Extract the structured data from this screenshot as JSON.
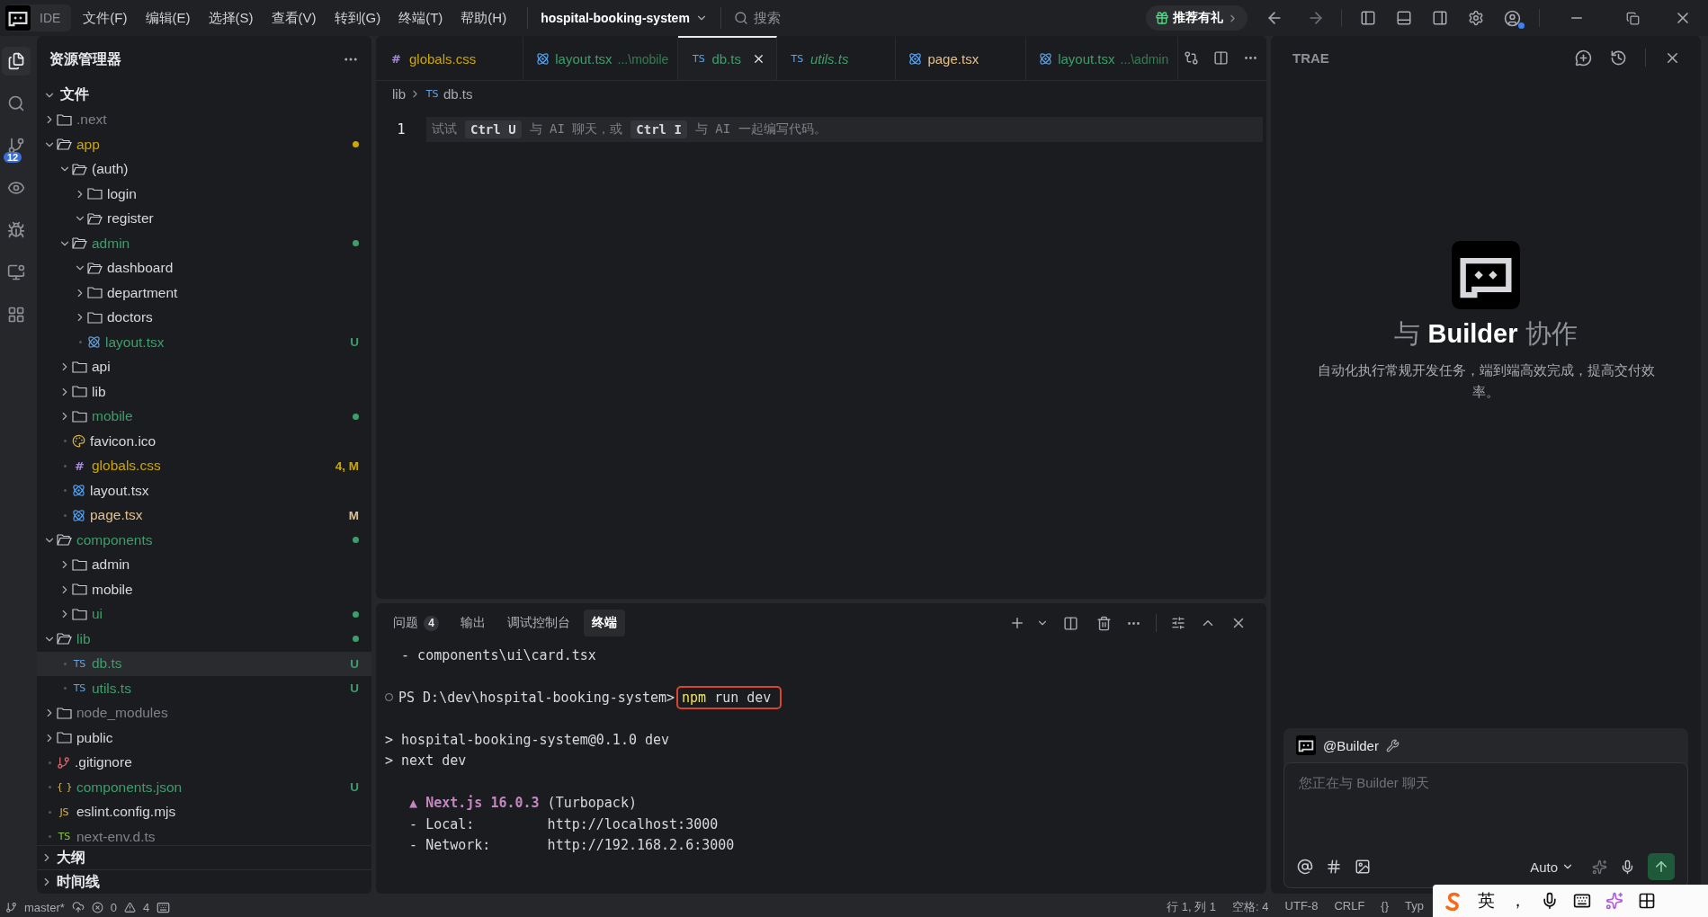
{
  "topbar": {
    "ide_label": "IDE",
    "menus": [
      "文件(F)",
      "编辑(E)",
      "选择(S)",
      "查看(V)",
      "转到(G)",
      "终端(T)",
      "帮助(H)"
    ],
    "project": "hospital-booking-system",
    "search": {
      "placeholder": "搜索"
    },
    "promo": "推荐有礼"
  },
  "activity": [
    {
      "kind": "files",
      "selected": true
    },
    {
      "kind": "search",
      "selected": false
    },
    {
      "kind": "git",
      "selected": false,
      "badge": "12"
    },
    {
      "kind": "eye",
      "selected": false
    },
    {
      "kind": "debug",
      "selected": false
    },
    {
      "kind": "remote",
      "selected": false
    },
    {
      "kind": "extensions",
      "selected": false
    }
  ],
  "explorer": {
    "title": "资源管理器",
    "root": {
      "label": "文件",
      "expanded": true
    },
    "files": [
      {
        "name": ".next",
        "kind": "folder",
        "color": "#7e8288",
        "has_changes": false,
        "expanded": false,
        "selected": false
      },
      {
        "name": "app",
        "kind": "folder",
        "color": "#cca700",
        "has_changes": true,
        "expanded": true,
        "selected": false,
        "children": [
          {
            "name": "(auth)",
            "kind": "folder",
            "color": "#d6d8dc",
            "has_changes": false,
            "expanded": true,
            "selected": false,
            "children": [
              {
                "name": "login",
                "kind": "folder",
                "color": "#d6d8dc",
                "has_changes": false,
                "expanded": false,
                "selected": false
              },
              {
                "name": "register",
                "kind": "folder",
                "color": "#d6d8dc",
                "has_changes": false,
                "expanded": true,
                "selected": false
              }
            ]
          },
          {
            "name": "admin",
            "kind": "folder",
            "color": "#3d9e6b",
            "has_changes": true,
            "expanded": true,
            "selected": false,
            "children": [
              {
                "name": "dashboard",
                "kind": "folder",
                "color": "#d6d8dc",
                "has_changes": false,
                "expanded": true,
                "selected": false
              },
              {
                "name": "department",
                "kind": "folder",
                "color": "#d6d8dc",
                "has_changes": false,
                "expanded": false,
                "selected": false
              },
              {
                "name": "doctors",
                "kind": "folder",
                "color": "#d6d8dc",
                "has_changes": false,
                "expanded": false,
                "selected": false
              },
              {
                "name": "layout.tsx",
                "kind": "react",
                "color": "#3d9e6b",
                "badge": "U",
                "selected": false
              }
            ]
          },
          {
            "name": "api",
            "kind": "folder",
            "color": "#d6d8dc",
            "has_changes": false,
            "expanded": false,
            "selected": false
          },
          {
            "name": "lib",
            "kind": "folder",
            "color": "#d6d8dc",
            "has_changes": false,
            "expanded": false,
            "selected": false
          },
          {
            "name": "mobile",
            "kind": "folder",
            "color": "#3d9e6b",
            "has_changes": true,
            "expanded": false,
            "selected": false
          },
          {
            "name": "favicon.ico",
            "kind": "favicon",
            "color": "#d6d8dc",
            "selected": false
          },
          {
            "name": "globals.css",
            "kind": "css",
            "glyph": "#",
            "color": "#cca700",
            "badge": "4, M",
            "selected": false
          },
          {
            "name": "layout.tsx",
            "kind": "react",
            "color": "#d6d8dc",
            "selected": false
          },
          {
            "name": "page.tsx",
            "kind": "react",
            "color": "#e2c08d",
            "badge": "M",
            "selected": false
          }
        ]
      },
      {
        "name": "components",
        "kind": "folder",
        "color": "#3d9e6b",
        "has_changes": true,
        "expanded": true,
        "selected": false,
        "children": [
          {
            "name": "admin",
            "kind": "folder",
            "color": "#d6d8dc",
            "has_changes": false,
            "expanded": false,
            "selected": false
          },
          {
            "name": "mobile",
            "kind": "folder",
            "color": "#d6d8dc",
            "has_changes": false,
            "expanded": false,
            "selected": false
          },
          {
            "name": "ui",
            "kind": "folder",
            "color": "#3d9e6b",
            "has_changes": true,
            "expanded": false,
            "selected": false
          }
        ]
      },
      {
        "name": "lib",
        "kind": "folder",
        "color": "#3d9e6b",
        "has_changes": true,
        "expanded": true,
        "selected": false,
        "children": [
          {
            "name": "db.ts",
            "kind": "ts",
            "glyph": "TS",
            "color": "#3d9e6b",
            "badge": "U",
            "selected": true
          },
          {
            "name": "utils.ts",
            "kind": "ts",
            "glyph": "TS",
            "color": "#3d9e6b",
            "badge": "U",
            "selected": false
          }
        ]
      },
      {
        "name": "node_modules",
        "kind": "folder",
        "color": "#7e8288",
        "has_changes": false,
        "expanded": false,
        "selected": false
      },
      {
        "name": "public",
        "kind": "folder",
        "color": "#d6d8dc",
        "has_changes": false,
        "expanded": false,
        "selected": false
      },
      {
        "name": ".gitignore",
        "kind": "git",
        "color": "#d6d8dc",
        "selected": false
      },
      {
        "name": "components.json",
        "kind": "json",
        "glyph": "{ }",
        "color": "#3d9e6b",
        "badge": "U",
        "selected": false
      },
      {
        "name": "eslint.config.mjs",
        "kind": "js",
        "glyph": "JS",
        "color": "#d6d8dc",
        "selected": false
      },
      {
        "name": "next-env.d.ts",
        "kind": "tsenv",
        "glyph": "TS",
        "color": "#7e8288",
        "selected": false
      }
    ],
    "sections": [
      {
        "title": "大纲",
        "expanded": false
      },
      {
        "title": "时间线",
        "expanded": false
      }
    ]
  },
  "tabs": [
    {
      "label": "globals.css",
      "kind": "css",
      "glyph": "#",
      "color": "#cca700",
      "selected": false,
      "preview": false
    },
    {
      "label": "layout.tsx",
      "hint": "...\\mobile",
      "kind": "react",
      "color": "#3d9e6b",
      "selected": false,
      "preview": false
    },
    {
      "label": "db.ts",
      "kind": "ts",
      "glyph": "TS",
      "color": "#3d9e6b",
      "selected": true,
      "preview": false
    },
    {
      "label": "utils.ts",
      "kind": "ts",
      "glyph": "TS",
      "color": "#3d9e6b",
      "selected": false,
      "preview": true
    },
    {
      "label": "page.tsx",
      "kind": "react",
      "color": "#e2c08d",
      "selected": false,
      "preview": false
    },
    {
      "label": "layout.tsx",
      "hint": "...\\admin",
      "kind": "react",
      "color": "#3d9e6b",
      "selected": false,
      "preview": false
    }
  ],
  "breadcrumb": [
    {
      "label": "lib"
    },
    {
      "label": "db.ts",
      "glyph": "TS"
    }
  ],
  "editor": {
    "line_number": "1",
    "hint": [
      {
        "kind": "text",
        "text": "试试"
      },
      {
        "kind": "key",
        "text": "Ctrl U"
      },
      {
        "kind": "text",
        "text": "与 AI 聊天，或"
      },
      {
        "kind": "key",
        "text": "Ctrl I"
      },
      {
        "kind": "text",
        "text": "与 AI 一起编写代码。"
      }
    ]
  },
  "panel": {
    "tabs": [
      {
        "label": "问题",
        "count": "4",
        "selected": false
      },
      {
        "label": "输出",
        "selected": false
      },
      {
        "label": "调试控制台",
        "selected": false
      },
      {
        "label": "终端",
        "selected": true
      }
    ],
    "terminal": [
      {
        "kind": "plain",
        "text": "  - components\\ui\\card.tsx"
      },
      {
        "kind": "blank"
      },
      {
        "kind": "prompt",
        "prompt": "PS D:\\dev\\hospital-booking-system>",
        "program": "npm",
        "args": "run dev"
      },
      {
        "kind": "blank"
      },
      {
        "kind": "plain",
        "text": "> hospital-booking-system@0.1.0 dev"
      },
      {
        "kind": "plain",
        "text": "> next dev"
      },
      {
        "kind": "blank"
      },
      {
        "kind": "banner",
        "accent": "   ▲ Next.js 16.0.3",
        "text": " (Turbopack)"
      },
      {
        "kind": "plain",
        "text": "   - Local:         http://localhost:3000"
      },
      {
        "kind": "plain",
        "text": "   - Network:       http://192.168.2.6:3000"
      }
    ]
  },
  "assistant": {
    "title": "TRAE",
    "heading": "与 **Builder** 协作",
    "description": "自动化执行常规开发任务，端到端高效完成，提高交付效率。",
    "agent": "@Builder",
    "input": {
      "placeholder": "您正在与 Builder 聊天"
    },
    "model": "Auto"
  },
  "status_bar": {
    "branch": "master*",
    "errors": "0",
    "warnings": "4",
    "right": [
      "行 1, 列 1",
      "空格: 4",
      "UTF-8",
      "CRLF",
      "{}",
      "Typ"
    ]
  },
  "ime_toolbar": {
    "mode": "英",
    "punctuation": "，"
  }
}
